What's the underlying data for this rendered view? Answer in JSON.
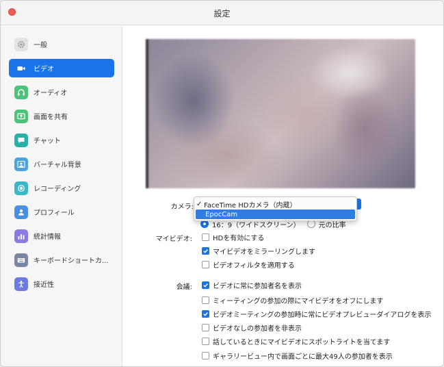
{
  "window": {
    "title": "設定",
    "accent": "#1a73e8"
  },
  "sidebar": {
    "items": [
      {
        "label": "一般",
        "icon": "gear-icon",
        "color": "#e6e6e6",
        "active": false
      },
      {
        "label": "ビデオ",
        "icon": "video-camera-icon",
        "color": "#1a73e8",
        "active": true
      },
      {
        "label": "オーディオ",
        "icon": "headphones-icon",
        "color": "#4cc27b",
        "active": false
      },
      {
        "label": "画面を共有",
        "icon": "share-screen-icon",
        "color": "#4cc27b",
        "active": false
      },
      {
        "label": "チャット",
        "icon": "chat-bubble-icon",
        "color": "#29b0a6",
        "active": false
      },
      {
        "label": "バーチャル背景",
        "icon": "virtual-background-icon",
        "color": "#4aa3df",
        "active": false
      },
      {
        "label": "レコーディング",
        "icon": "record-icon",
        "color": "#3db6c8",
        "active": false
      },
      {
        "label": "プロフィール",
        "icon": "profile-icon",
        "color": "#4a90e2",
        "active": false
      },
      {
        "label": "統計情報",
        "icon": "statistics-icon",
        "color": "#8a7be0",
        "active": false
      },
      {
        "label": "キーボードショートカ...",
        "icon": "keyboard-icon",
        "color": "#7b86a6",
        "active": false
      },
      {
        "label": "接近性",
        "icon": "accessibility-icon",
        "color": "#6b7be0",
        "active": false
      }
    ]
  },
  "video": {
    "camera_label": "カメラ:",
    "camera_options": [
      {
        "label": "FaceTime HDカメラ（内蔵）",
        "selected": true
      },
      {
        "label": "EpocCam",
        "selected": false,
        "highlighted": true
      }
    ],
    "ratio_options": [
      {
        "label": "16：9（ワイドスクリーン）",
        "selected": true
      },
      {
        "label": "元の比率",
        "selected": false
      }
    ],
    "my_video_label": "マイビデオ:",
    "my_video_options": [
      {
        "label": "HDを有効にする",
        "checked": false
      },
      {
        "label": "マイビデオをミラーリングします",
        "checked": true
      },
      {
        "label": "ビデオフィルタを適用する",
        "checked": false
      }
    ],
    "meeting_label": "会議:",
    "meeting_options": [
      {
        "label": "ビデオに常に参加者名を表示",
        "checked": true
      },
      {
        "label": "ミィーティングの参加の際にマイビデオをオフにします",
        "checked": false
      },
      {
        "label": "ビデオミーティングの参加時に常にビデオプレビューダイアログを表示",
        "checked": true
      },
      {
        "label": "ビデオなしの参加者を非表示",
        "checked": false
      },
      {
        "label": "話しているときにマイビデオにスポットライトを当てます",
        "checked": false
      },
      {
        "label": "ギャラリービュー内で画面ごとに最大49人の参加者を表示",
        "checked": false
      }
    ]
  }
}
